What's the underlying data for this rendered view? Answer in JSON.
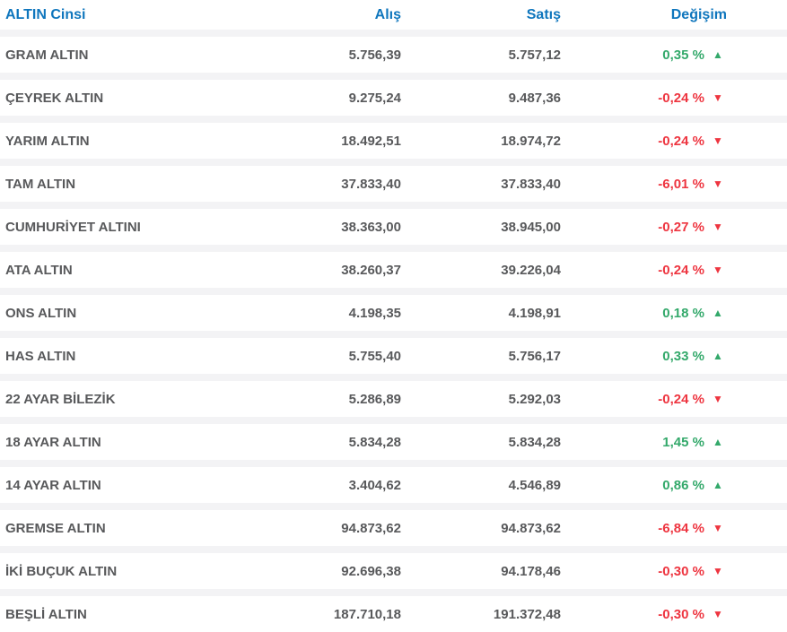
{
  "widget_title": "Gold prices table (Turkish)",
  "colors": {
    "header_blue": "#0f76bd",
    "up_green": "#34a96b",
    "down_red": "#ee3540",
    "text_gray": "#58595b",
    "separator_gray": "#f3f3f5",
    "row_background": "#ffffff"
  },
  "icons": {
    "up": "▲",
    "down": "▼"
  },
  "table": {
    "columns": [
      "ALTIN Cinsi",
      "Alış",
      "Satış",
      "Değişim"
    ],
    "rows": [
      {
        "name": "GRAM ALTIN",
        "buy": "5.756,39",
        "sell": "5.757,12",
        "change": "0,35 %",
        "direction": "up"
      },
      {
        "name": "ÇEYREK ALTIN",
        "buy": "9.275,24",
        "sell": "9.487,36",
        "change": "-0,24 %",
        "direction": "down"
      },
      {
        "name": "YARIM ALTIN",
        "buy": "18.492,51",
        "sell": "18.974,72",
        "change": "-0,24 %",
        "direction": "down"
      },
      {
        "name": "TAM ALTIN",
        "buy": "37.833,40",
        "sell": "37.833,40",
        "change": "-6,01 %",
        "direction": "down"
      },
      {
        "name": "CUMHURİYET ALTINI",
        "buy": "38.363,00",
        "sell": "38.945,00",
        "change": "-0,27 %",
        "direction": "down"
      },
      {
        "name": "ATA ALTIN",
        "buy": "38.260,37",
        "sell": "39.226,04",
        "change": "-0,24 %",
        "direction": "down"
      },
      {
        "name": "ONS ALTIN",
        "buy": "4.198,35",
        "sell": "4.198,91",
        "change": "0,18 %",
        "direction": "up"
      },
      {
        "name": "HAS ALTIN",
        "buy": "5.755,40",
        "sell": "5.756,17",
        "change": "0,33 %",
        "direction": "up"
      },
      {
        "name": "22 AYAR BİLEZİK",
        "buy": "5.286,89",
        "sell": "5.292,03",
        "change": "-0,24 %",
        "direction": "down"
      },
      {
        "name": "18 AYAR ALTIN",
        "buy": "5.834,28",
        "sell": "5.834,28",
        "change": "1,45 %",
        "direction": "up"
      },
      {
        "name": "14 AYAR ALTIN",
        "buy": "3.404,62",
        "sell": "4.546,89",
        "change": "0,86 %",
        "direction": "up"
      },
      {
        "name": "GREMSE ALTIN",
        "buy": "94.873,62",
        "sell": "94.873,62",
        "change": "-6,84 %",
        "direction": "down"
      },
      {
        "name": "İKİ BUÇUK ALTIN",
        "buy": "92.696,38",
        "sell": "94.178,46",
        "change": "-0,30 %",
        "direction": "down"
      },
      {
        "name": "BEŞLİ ALTIN",
        "buy": "187.710,18",
        "sell": "191.372,48",
        "change": "-0,30 %",
        "direction": "down"
      }
    ]
  },
  "chart_data": {
    "type": "table",
    "title": "ALTIN Cinsi",
    "columns": [
      "ALTIN Cinsi",
      "Alış",
      "Satış",
      "Değişim"
    ],
    "rows": [
      [
        "GRAM ALTIN",
        5756.39,
        5757.12,
        0.35
      ],
      [
        "ÇEYREK ALTIN",
        9275.24,
        9487.36,
        -0.24
      ],
      [
        "YARIM ALTIN",
        18492.51,
        18974.72,
        -0.24
      ],
      [
        "TAM ALTIN",
        37833.4,
        37833.4,
        -6.01
      ],
      [
        "CUMHURİYET ALTINI",
        38363.0,
        38945.0,
        -0.27
      ],
      [
        "ATA ALTIN",
        38260.37,
        39226.04,
        -0.24
      ],
      [
        "ONS ALTIN",
        4198.35,
        4198.91,
        0.18
      ],
      [
        "HAS ALTIN",
        5755.4,
        5756.17,
        0.33
      ],
      [
        "22 AYAR BİLEZİK",
        5286.89,
        5292.03,
        -0.24
      ],
      [
        "18 AYAR ALTIN",
        5834.28,
        5834.28,
        1.45
      ],
      [
        "14 AYAR ALTIN",
        3404.62,
        4546.89,
        0.86
      ],
      [
        "GREMSE ALTIN",
        94873.62,
        94873.62,
        -6.84
      ],
      [
        "İKİ BUÇUK ALTIN",
        92696.38,
        94178.46,
        -0.3
      ],
      [
        "BEŞLİ ALTIN",
        187710.18,
        191372.48,
        -0.3
      ]
    ]
  }
}
